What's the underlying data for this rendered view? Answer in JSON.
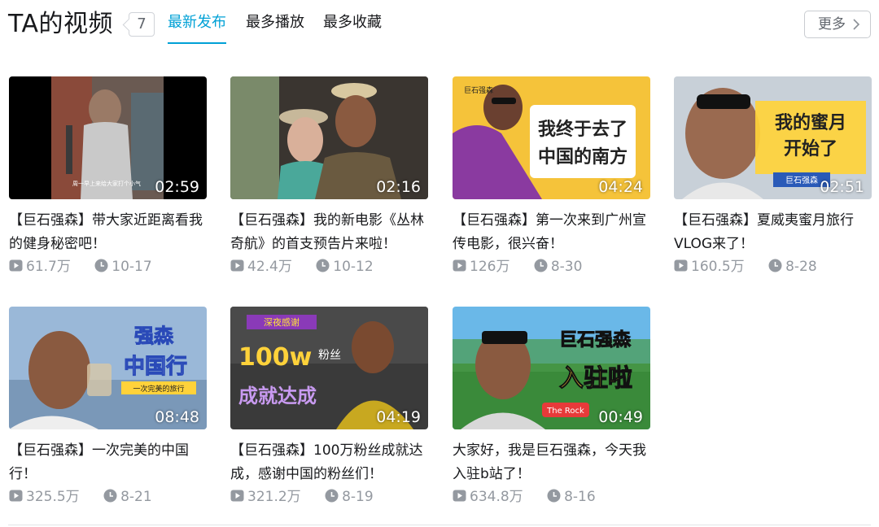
{
  "header": {
    "title": "TA的视频",
    "video_count": "7",
    "tabs": [
      {
        "label": "最新发布",
        "active": true
      },
      {
        "label": "最多播放",
        "active": false
      },
      {
        "label": "最多收藏",
        "active": false
      }
    ],
    "more_label": "更多"
  },
  "colors": {
    "accent": "#00a1d6",
    "text": "#18191c",
    "muted": "#9499a0"
  },
  "icons": {
    "views": "play-count-icon",
    "date": "clock-icon",
    "more": "chevron-right-icon"
  },
  "videos": [
    {
      "title": "【巨石强森】带大家近距离看我的健身秘密吧！",
      "duration": "02:59",
      "views": "61.7万",
      "date": "10-17",
      "thumb_caption": "周一早上来给大家打个小气"
    },
    {
      "title": "【巨石强森】我的新电影《丛林奇航》的首支预告片来啦！",
      "duration": "02:16",
      "views": "42.4万",
      "date": "10-12"
    },
    {
      "title": "【巨石强森】第一次来到广州宣传电影，很兴奋！",
      "duration": "04:24",
      "views": "126万",
      "date": "8-30",
      "thumb_text": [
        "我终于去了",
        "中国的南方"
      ],
      "thumb_tag": "巨石强森"
    },
    {
      "title": "【巨石强森】夏威夷蜜月旅行VLOG来了！",
      "duration": "02:51",
      "views": "160.5万",
      "date": "8-28",
      "thumb_text": [
        "我的蜜月",
        "开始了"
      ],
      "thumb_tag": "巨石强森"
    },
    {
      "title": "【巨石强森】一次完美的中国行！",
      "duration": "08:48",
      "views": "325.5万",
      "date": "8-21",
      "thumb_text": [
        "强森",
        "中国行"
      ],
      "thumb_tag": "一次完美的旅行"
    },
    {
      "title": "【巨石强森】100万粉丝成就达成，感谢中国的粉丝们！",
      "duration": "04:19",
      "views": "321.2万",
      "date": "8-19",
      "thumb_text": [
        "100w",
        "粉丝",
        "成就达成"
      ],
      "thumb_tag": "深夜感谢"
    },
    {
      "title": "大家好，我是巨石强森，今天我入驻b站了！",
      "duration": "00:49",
      "views": "634.8万",
      "date": "8-16",
      "thumb_text": [
        "巨石强森",
        "入驻啦"
      ],
      "thumb_tag": "The Rock"
    }
  ]
}
